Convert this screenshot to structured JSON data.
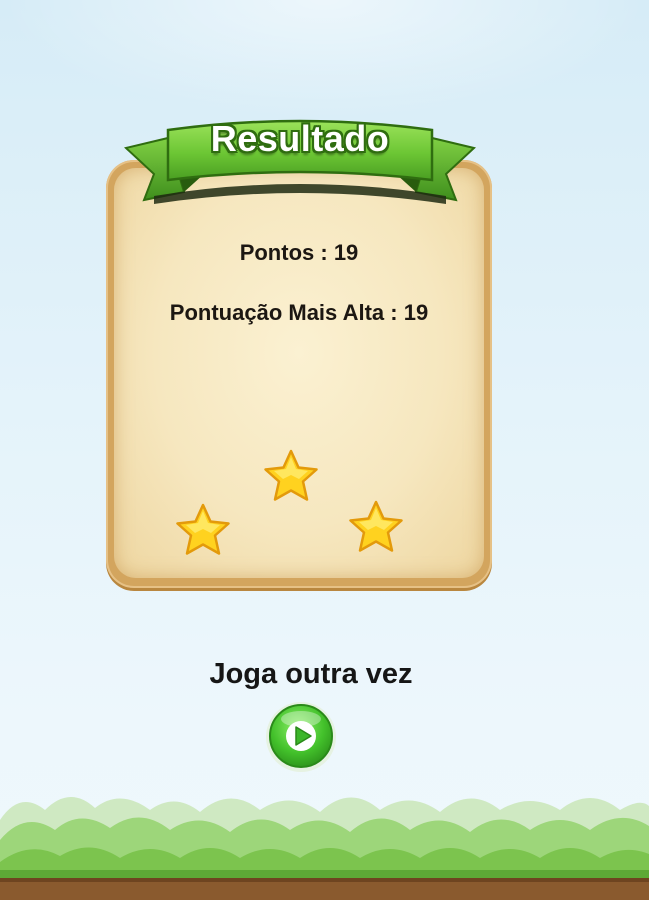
{
  "result_panel": {
    "title": "Resultado",
    "score_label": "Pontos",
    "score_value": "19",
    "high_score_label": "Pontuação Mais Alta",
    "high_score_value": "19",
    "separator": " : ",
    "stars_earned": 3,
    "stars_total": 3
  },
  "play_again": {
    "label": "Joga outra vez",
    "icon": "play-icon"
  },
  "colors": {
    "ribbon_green": "#6cc634",
    "ribbon_dark": "#2f6d10",
    "star_gold": "#ffd21f",
    "button_green": "#43c12b",
    "parchment": "#f6e7bf"
  }
}
